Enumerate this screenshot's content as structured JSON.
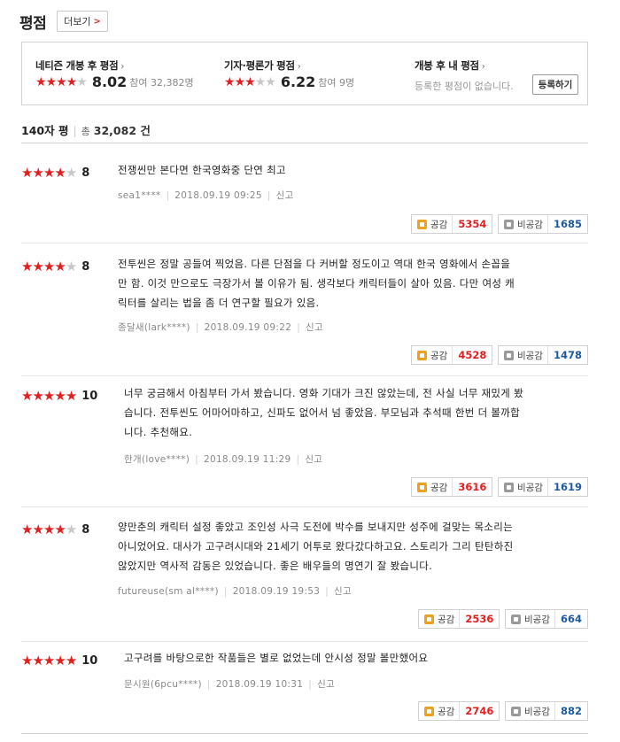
{
  "section": {
    "title": "평점",
    "more_label": "더보기",
    "more_chevron": ">"
  },
  "summary": {
    "netizen": {
      "title": "네티즌 개봉 후 평점",
      "arrow": "›",
      "score": "8.02",
      "count": "참여 32,382명",
      "stars_filled": 4
    },
    "critic": {
      "title": "기자·평론가 평점",
      "arrow": "›",
      "score": "6.22",
      "count": "참여 9명",
      "stars_filled": 3
    },
    "mine": {
      "title": "개봉 후 내 평점",
      "arrow": "›",
      "note": "등록한 평점이 없습니다.",
      "register_label": "등록하기"
    }
  },
  "list": {
    "title": "140자 평",
    "total_label": "총",
    "total_value": "32,082 건"
  },
  "colors": {
    "accent": "#e02020",
    "like": "#e02020",
    "dislike": "#1e5aa0",
    "star_off": "#c8c8c8"
  },
  "reviews": [
    {
      "stars": 4,
      "score": "8",
      "lines": [
        "전쟁씬만 본다면 한국영화중 단연 최고"
      ],
      "user": "sea1****",
      "date": "2018.09.19 09:25",
      "report": "신고",
      "like_label": "공감",
      "likes": "5354",
      "dislike_label": "비공감",
      "dislikes": "1685"
    },
    {
      "stars": 4,
      "score": "8",
      "lines": [
        "전투씬은 정말 공들여 찍었음. 다른 단점을 다 커버할 정도이고 역대 한국 영화에서 손꼽을",
        "만 함. 이것 만으로도 극장가서 볼 이유가 됨. 생각보다 캐릭터들이 살아 있음. 다만 여성 캐",
        "릭터를 살리는 법을 좀 더 연구할 필요가 있음."
      ],
      "user": "종달새(lark****)",
      "date": "2018.09.19 09:22",
      "report": "신고",
      "like_label": "공감",
      "likes": "4528",
      "dislike_label": "비공감",
      "dislikes": "1478"
    },
    {
      "stars": 5,
      "score": "10",
      "lines": [
        "너무 궁금해서 아침부터 가서 봤습니다. 영화 기대가 크진 않았는데, 전 사실 너무 재밌게 봤",
        "습니다. 전투씬도 어마어마하고, 신파도 없어서 넘 좋았음. 부모님과 추석때 한번 더 볼까합",
        "니다. 추천해요."
      ],
      "user": "한개(love****)",
      "date": "2018.09.19 11:29",
      "report": "신고",
      "like_label": "공감",
      "likes": "3616",
      "dislike_label": "비공감",
      "dislikes": "1619"
    },
    {
      "stars": 4,
      "score": "8",
      "lines": [
        "양만춘의 캐릭터 설정 좋았고 조인성 사극 도전에 박수를 보내지만 성주에 걸맞는 목소리는",
        "아니었어요. 대사가 고구려시대와 21세기 어투로 왔다갔다하고요. 스토리가 그리 탄탄하진",
        "않았지만 역사적 감동은 있었습니다. 좋은 배우들의 명연기 잘 봤습니다."
      ],
      "user": "futureuse(sm al****)",
      "date": "2018.09.19 19:53",
      "report": "신고",
      "like_label": "공감",
      "likes": "2536",
      "dislike_label": "비공감",
      "dislikes": "664"
    },
    {
      "stars": 5,
      "score": "10",
      "lines": [
        "고구려를 바탕으로한 작품들은 별로 없었는데 안시성 정말 볼만했어요"
      ],
      "user": "문시원(6pcu****)",
      "date": "2018.09.19 10:31",
      "report": "신고",
      "like_label": "공감",
      "likes": "2746",
      "dislike_label": "비공감",
      "dislikes": "882"
    }
  ]
}
